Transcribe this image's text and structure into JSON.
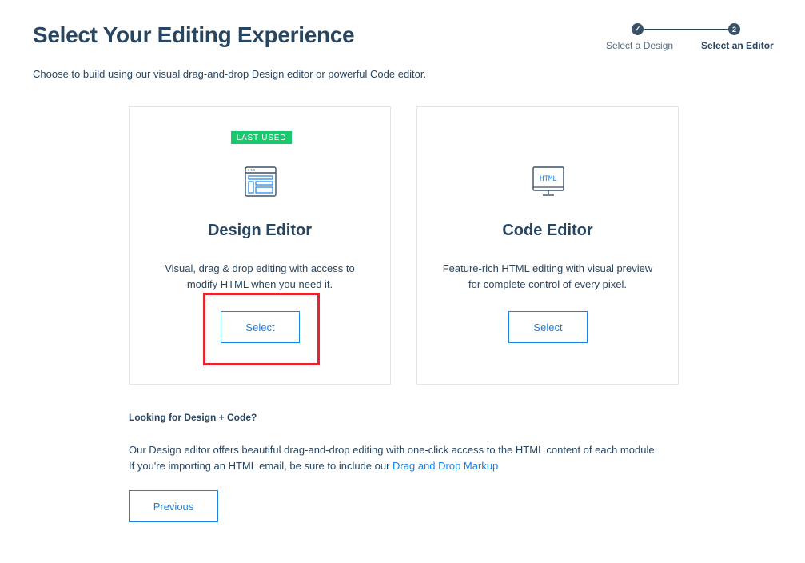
{
  "header": {
    "title": "Select Your Editing Experience",
    "subtitle": "Choose to build using our visual drag-and-drop Design editor or powerful Code editor."
  },
  "stepper": {
    "steps": [
      {
        "label": "Select a Design",
        "marker": "✓",
        "state": "completed"
      },
      {
        "label": "Select an Editor",
        "marker": "2",
        "state": "current"
      }
    ]
  },
  "cards": {
    "design": {
      "badge": "LAST USED",
      "icon": "layout-editor-icon",
      "title": "Design Editor",
      "description": "Visual, drag & drop editing with access to modify HTML when you need it.",
      "button_label": "Select"
    },
    "code": {
      "icon": "html-monitor-icon",
      "icon_text": "HTML",
      "title": "Code Editor",
      "description": "Feature-rich HTML editing with visual preview for complete control of every pixel.",
      "button_label": "Select"
    }
  },
  "help": {
    "heading": "Looking for Design + Code?",
    "line1": "Our Design editor offers beautiful drag-and-drop editing with one-click access to the HTML content of each module.",
    "line2_prefix": "If you're importing an HTML email, be sure to include our ",
    "link_label": "Drag and Drop Markup"
  },
  "footer": {
    "previous_label": "Previous"
  },
  "colors": {
    "text": "#294661",
    "accent": "#1a82e2",
    "badge": "#18c96e",
    "highlight": "#e3262e",
    "border": "#e1e4e8"
  }
}
